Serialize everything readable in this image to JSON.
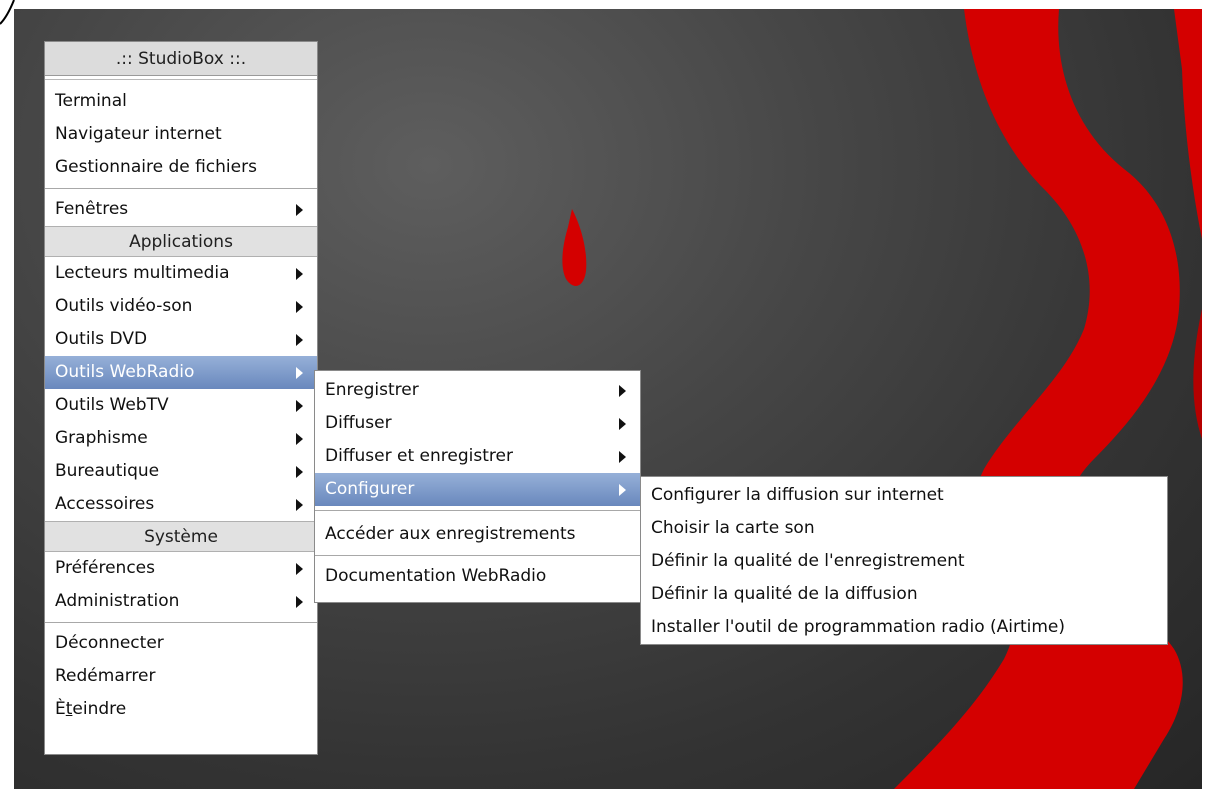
{
  "main_menu": {
    "title": ".:: StudioBox ::.",
    "items_top": [
      "Terminal",
      "Navigateur internet",
      "Gestionnaire de fichiers"
    ],
    "fenetres": "Fenêtres",
    "applications_header": "Applications",
    "applications": [
      "Lecteurs multimedia",
      "Outils vidéo-son",
      "Outils DVD",
      "Outils WebRadio",
      "Outils WebTV",
      "Graphisme",
      "Bureautique",
      "Accessoires"
    ],
    "systeme_header": "Système",
    "systeme": [
      "Préférences",
      "Administration"
    ],
    "session": [
      "Déconnecter",
      "Redémarrer"
    ],
    "shutdown_first": "È",
    "shutdown_mnemonic": "t",
    "shutdown_rest": "eindre"
  },
  "webradio_menu": {
    "items": [
      "Enregistrer",
      "Diffuser",
      "Diffuser et enregistrer",
      "Configurer",
      "Accéder aux enregistrements",
      "Documentation WebRadio"
    ]
  },
  "configurer_menu": {
    "items": [
      "Configurer la diffusion sur internet",
      "Choisir la carte son",
      "Définir la qualité de l'enregistrement",
      "Définir la qualité de la diffusion",
      "Installer l'outil de programmation radio (Airtime)"
    ]
  },
  "colors": {
    "selection": "#7893c6",
    "wallpaper_red": "#d40000",
    "wallpaper_dark": "#3a3a3a"
  }
}
